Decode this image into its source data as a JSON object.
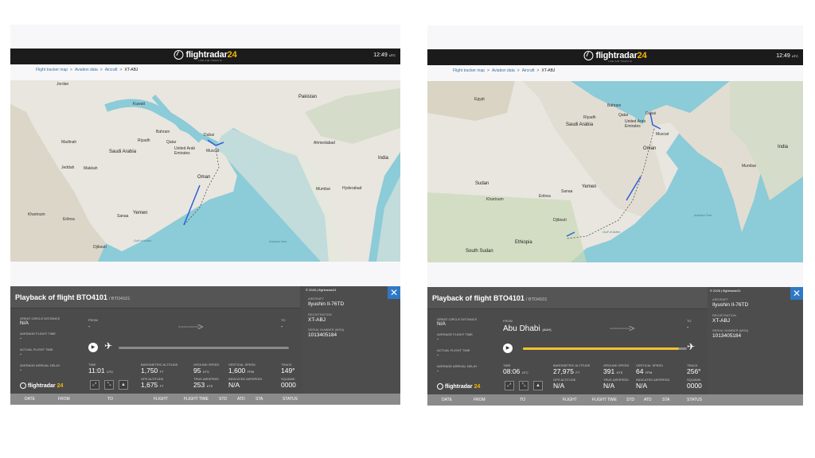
{
  "brand": {
    "name": "flightradar",
    "num": "24",
    "sub": "LIVE AIR TRAFFIC"
  },
  "breadcrumbs": [
    "Flight tracker map",
    "Aviation data",
    "Aircraft",
    "XT-ABJ"
  ],
  "colors": {
    "topbar": "#1b1b1b",
    "accent": "#f1c232",
    "close": "#2f78c5",
    "track": "#2f5fd6"
  },
  "panels": [
    {
      "clock": {
        "time": "12:49",
        "zone": "UTC"
      },
      "map_labels": [
        "Jordan",
        "Kuwait",
        "Pakistan",
        "Bahrain",
        "Qatar",
        "Riyadh",
        "Dubai",
        "Muscat",
        "United Arab Emirates",
        "Saudi Arabia",
        "Madinah",
        "Jeddah",
        "Makkah",
        "Oman",
        "India",
        "Mumbai",
        "Yemen",
        "Sanaa",
        "Eritrea",
        "Khartoum",
        "Djibouti",
        "Gulf of Aden",
        "Arabian Sea",
        "Hyderabad",
        "Ahmedabad"
      ],
      "playback": {
        "title": "Playback of flight BTO4101",
        "callsign": "/ BTO4101"
      },
      "sidebar": [
        {
          "label": "GREAT CIRCLE DISTANCE",
          "value": "N/A"
        },
        {
          "label": "AVERAGE FLIGHT TIME",
          "value": "-"
        },
        {
          "label": "ACTUAL FLIGHT TIME",
          "value": "-"
        },
        {
          "label": "AVERAGE ARRIVAL DELAY",
          "value": "-"
        }
      ],
      "route": {
        "from_label": "FROM",
        "from": "-",
        "to_label": "TO",
        "to": "-"
      },
      "progress": 0.0,
      "metrics": {
        "time": {
          "label": "TIME",
          "value": "11:01",
          "unit": "UTC"
        },
        "baro_alt": {
          "label": "BAROMETRIC ALTITUDE",
          "value": "1,750",
          "unit": "FT"
        },
        "ground_speed": {
          "label": "GROUND SPEED",
          "value": "95",
          "unit": "KTS"
        },
        "vertical_speed": {
          "label": "VERTICAL SPEED",
          "value": "1,600",
          "unit": "FPM"
        },
        "track": {
          "label": "TRACK",
          "value": "149°"
        },
        "gps_alt": {
          "label": "GPS ALTITUDE",
          "value": "1,675",
          "unit": "FT"
        },
        "true_airspeed": {
          "label": "TRUE AIRSPEED",
          "value": "253",
          "unit": "KTS"
        },
        "indicated_airspeed": {
          "label": "INDICATED AIRSPEED",
          "value": "N/A"
        },
        "squawk": {
          "label": "SQUAWK",
          "value": "0000"
        }
      },
      "info": {
        "copyright": "© 2026 | flightradar24",
        "aircraft_label": "AIRCRAFT",
        "aircraft": "Ilyushin Il-76TD",
        "reg_label": "REGISTRATION",
        "reg": "XT-ABJ",
        "msn_label": "SERIAL NUMBER (MSN)",
        "msn": "1013405184"
      },
      "table_headers": [
        "DATE",
        "FROM",
        "TO",
        "FLIGHT",
        "FLIGHT TIME",
        "STD",
        "ATD",
        "STA",
        "STATUS"
      ]
    },
    {
      "clock": {
        "time": "12:49",
        "zone": "UTC"
      },
      "map_labels": [
        "Egypt",
        "Bahrain",
        "Qatar",
        "Dubai",
        "Saudi Arabia",
        "Riyadh",
        "United Arab Emirates",
        "Oman",
        "Muscat",
        "India",
        "Mumbai",
        "Yemen",
        "Sudan",
        "Eritrea",
        "Djibouti",
        "Ethiopia",
        "South Sudan",
        "Arabian Sea",
        "Gulf of Aden",
        "Sanaa",
        "Khartoum"
      ],
      "playback": {
        "title": "Playback of flight BTO4101",
        "callsign": "/ BTO4101"
      },
      "sidebar": [
        {
          "label": "GREAT CIRCLE DISTANCE",
          "value": "N/A"
        },
        {
          "label": "AVERAGE FLIGHT TIME",
          "value": "-"
        },
        {
          "label": "ACTUAL FLIGHT TIME",
          "value": "-"
        },
        {
          "label": "AVERAGE ARRIVAL DELAY",
          "value": "-"
        }
      ],
      "route": {
        "from_label": "FROM",
        "from": "Abu Dhabi",
        "from_code": "(AUH)",
        "to_label": "TO",
        "to": "-"
      },
      "progress": 0.95,
      "metrics": {
        "time": {
          "label": "TIME",
          "value": "08:06",
          "unit": "UTC"
        },
        "baro_alt": {
          "label": "BAROMETRIC ALTITUDE",
          "value": "27,975",
          "unit": "FT"
        },
        "ground_speed": {
          "label": "GROUND SPEED",
          "value": "391",
          "unit": "KTS"
        },
        "vertical_speed": {
          "label": "VERTICAL SPEED",
          "value": "64",
          "unit": "FPM"
        },
        "track": {
          "label": "TRACK",
          "value": "256°"
        },
        "gps_alt": {
          "label": "GPS ALTITUDE",
          "value": "N/A"
        },
        "true_airspeed": {
          "label": "TRUE AIRSPEED",
          "value": "N/A"
        },
        "indicated_airspeed": {
          "label": "INDICATED AIRSPEED",
          "value": "N/A"
        },
        "squawk": {
          "label": "SQUAWK",
          "value": "0000"
        }
      },
      "info": {
        "copyright": "© 2026 | flightradar24",
        "aircraft_label": "AIRCRAFT",
        "aircraft": "Ilyushin Il-76TD",
        "reg_label": "REGISTRATION",
        "reg": "XT-ABJ",
        "msn_label": "SERIAL NUMBER (MSN)",
        "msn": "1013405184"
      },
      "table_headers": [
        "DATE",
        "FROM",
        "TO",
        "FLIGHT",
        "FLIGHT TIME",
        "STD",
        "ATD",
        "STA",
        "STATUS"
      ]
    }
  ]
}
